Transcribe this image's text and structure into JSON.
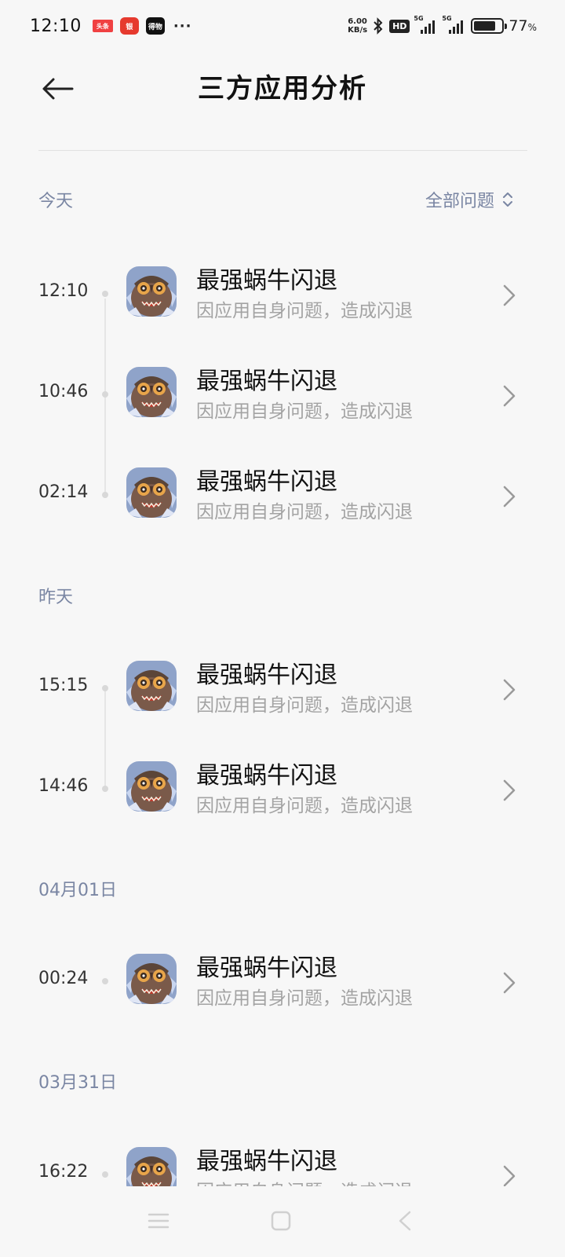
{
  "status_bar": {
    "time": "12:10",
    "app_icons": [
      "头条",
      "银",
      "得物"
    ],
    "more": "···",
    "net_speed_value": "6.00",
    "net_speed_unit": "KB/s",
    "hd_badge": "HD",
    "signal1_tag": "5G",
    "signal2_tag": "5G",
    "battery_percent": "77",
    "battery_percent_sign": "%",
    "battery_level": 0.77
  },
  "header": {
    "title": "三方应用分析"
  },
  "filter": {
    "label": "全部问题"
  },
  "sections": [
    {
      "label": "今天"
    },
    {
      "label": "昨天"
    },
    {
      "label": "04月01日"
    },
    {
      "label": "03月31日"
    }
  ],
  "rows": [
    {
      "time": "12:10",
      "name": "最强蜗牛闪退",
      "desc": "因应用自身问题，造成闪退"
    },
    {
      "time": "10:46",
      "name": "最强蜗牛闪退",
      "desc": "因应用自身问题，造成闪退"
    },
    {
      "time": "02:14",
      "name": "最强蜗牛闪退",
      "desc": "因应用自身问题，造成闪退"
    },
    {
      "time": "15:15",
      "name": "最强蜗牛闪退",
      "desc": "因应用自身问题，造成闪退"
    },
    {
      "time": "14:46",
      "name": "最强蜗牛闪退",
      "desc": "因应用自身问题，造成闪退"
    },
    {
      "time": "00:24",
      "name": "最强蜗牛闪退",
      "desc": "因应用自身问题，造成闪退"
    },
    {
      "time": "16:22",
      "name": "最强蜗牛闪退",
      "desc": "因应用自身问题，造成闪退"
    }
  ],
  "icons": {
    "back": "back-arrow-icon",
    "filter": "sort-updown-icon",
    "chevron": "chevron-right-icon",
    "app": "snail-game-app-icon",
    "nav_menu": "menu-icon",
    "nav_home": "home-square-icon",
    "nav_back": "back-triangle-icon"
  },
  "colors": {
    "background": "#f7f7f7",
    "section_label": "#7a86a3",
    "secondary_text": "#a3a3a3"
  }
}
